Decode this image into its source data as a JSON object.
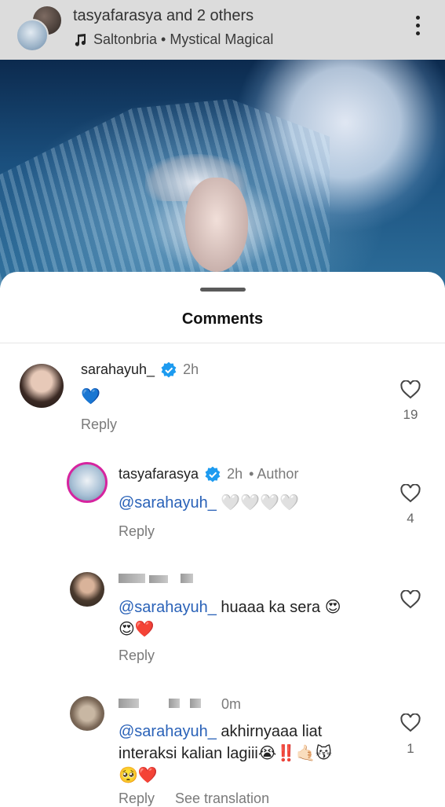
{
  "header": {
    "title": "tasyafarasya and 2 others",
    "music": "Saltonbria • Mystical Magical"
  },
  "sheet": {
    "title": "Comments"
  },
  "comments": [
    {
      "username": "sarahayuh_",
      "time": "2h",
      "text": "💙",
      "reply_label": "Reply",
      "likes": "19"
    },
    {
      "username": "tasyafarasya",
      "time": "2h",
      "author_tag": "• Author",
      "mention": "@sarahayuh_",
      "text": " 🤍🤍🤍🤍",
      "reply_label": "Reply",
      "likes": "4"
    },
    {
      "mention": "@sarahayuh_",
      "text_line1": " huaaa ka sera 😍",
      "text_line2": "😍❤️",
      "reply_label": "Reply"
    },
    {
      "time_partial": "0m",
      "mention": "@sarahayuh_",
      "text_line1": " akhirnyaaa liat",
      "text_line2": "interaksi kalian lagiii😭‼️🤙🏻😽",
      "text_line3": "🥺❤️",
      "reply_label": "Reply",
      "translate_label": "See translation",
      "likes": "1"
    }
  ],
  "colors": {
    "mention": "#2a62b8",
    "verified": "#1d9bf0"
  }
}
